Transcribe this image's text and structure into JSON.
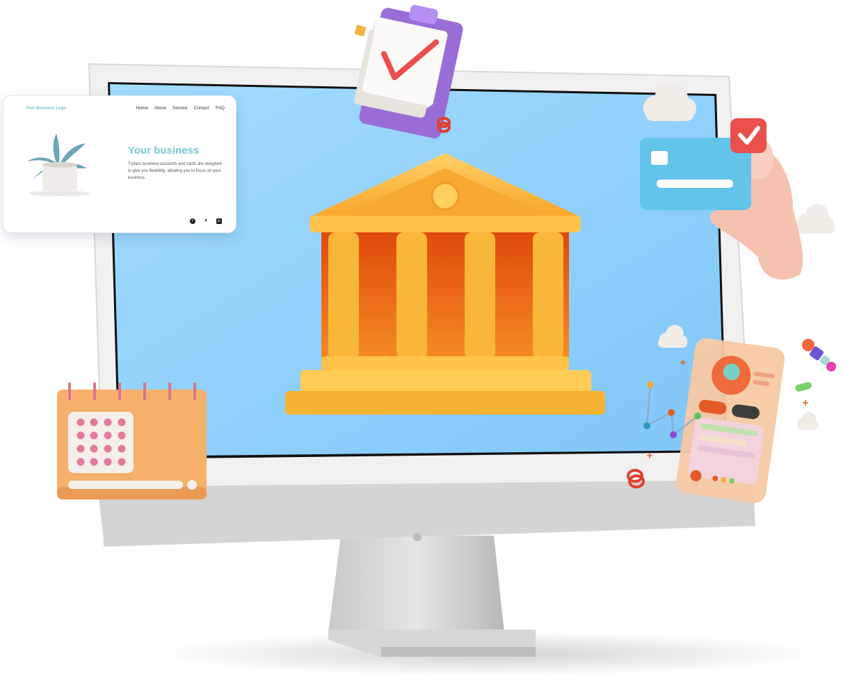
{
  "website_card": {
    "logo_text": "Your Business Logo",
    "nav": [
      "Home",
      "About",
      "Service",
      "Contact",
      "FAQ"
    ],
    "heading": "Your business",
    "description": "Tryba's business accounts and cards are designed to give you flexibility, allowing you to focus on your business.",
    "social_icons": [
      "facebook-icon",
      "twitter-icon",
      "linkedin-icon"
    ]
  },
  "colors": {
    "screen": "#8fd1fb",
    "bank_gold": "#fbb63a",
    "bank_inner": "#e85b13",
    "card_blue": "#63c4ea",
    "check_red": "#ea4f4b",
    "calendar_orange": "#f5b06b",
    "clipboard_purple": "#9a6dd6"
  },
  "illustration_elements": [
    "bank-building-icon",
    "clipboard-checklist-icon",
    "credit-card-icon",
    "hand-icon",
    "calendar-icon",
    "mobile-profile-icon",
    "cloud-icon"
  ]
}
